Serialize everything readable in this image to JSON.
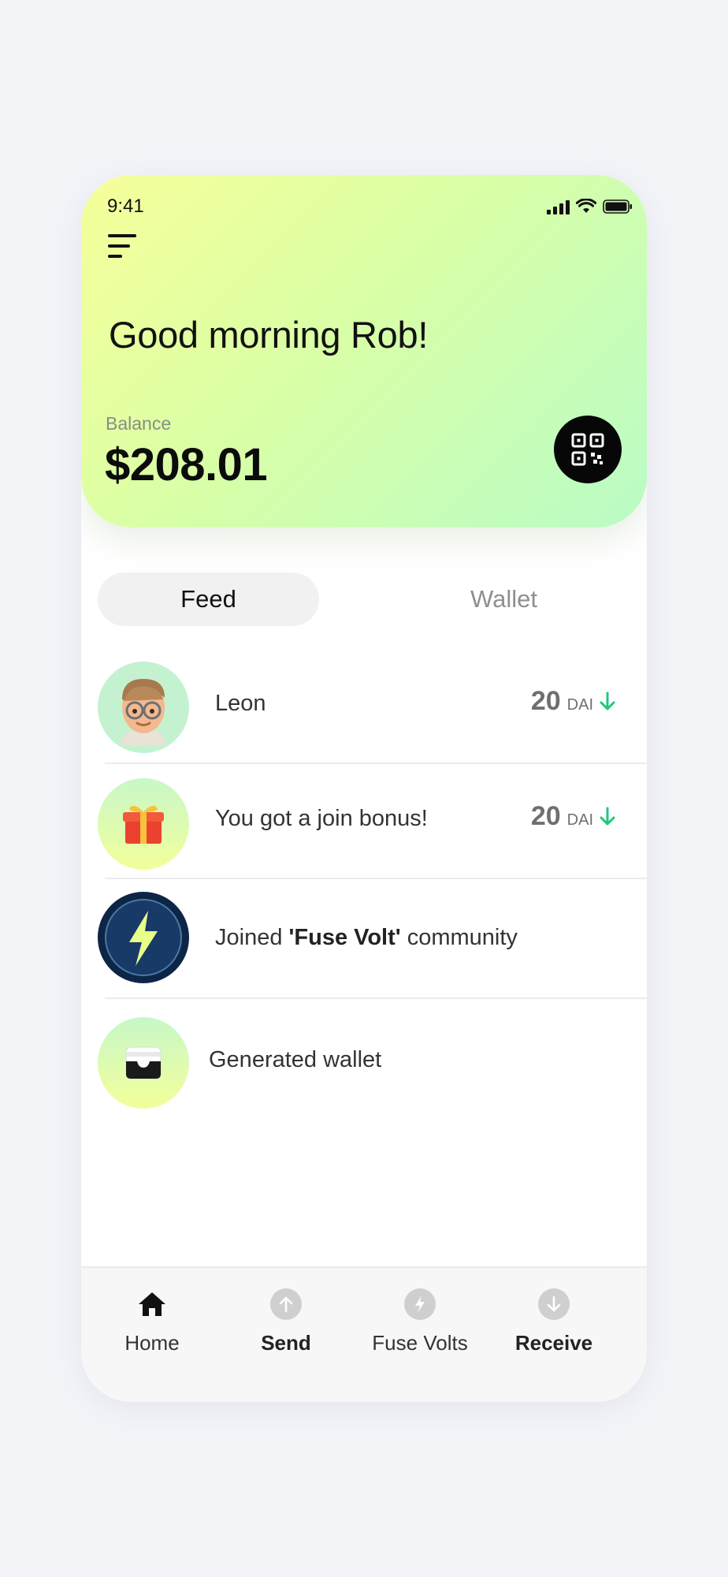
{
  "status_bar": {
    "time": "9:41"
  },
  "header": {
    "greeting": "Good morning Rob!",
    "balance_label": "Balance",
    "balance_value": "$208.01"
  },
  "tabs": [
    {
      "label": "Feed",
      "active": true
    },
    {
      "label": "Wallet",
      "active": false
    }
  ],
  "feed": {
    "items": [
      {
        "name": "Leon",
        "amount": "20",
        "unit": "DAI",
        "direction": "incoming",
        "avatar_icon": "memoji-avatar-icon"
      },
      {
        "name": "You got a join bonus!",
        "amount": "20",
        "unit": "DAI",
        "direction": "incoming",
        "avatar_icon": "gift-icon"
      },
      {
        "name_prefix": "Joined ",
        "name_bold": "'Fuse Volt'",
        "name_suffix": " community",
        "avatar_icon": "fuse-volt-bolt-icon"
      },
      {
        "name": "Generated wallet",
        "avatar_icon": "wallet-icon"
      }
    ]
  },
  "bottom_nav": {
    "items": [
      {
        "label": "Home",
        "icon": "home-icon"
      },
      {
        "label": "Send",
        "icon": "arrow-up-circle-icon"
      },
      {
        "label": "Fuse Volts",
        "icon": "bolt-circle-icon"
      },
      {
        "label": "Receive",
        "icon": "arrow-down-circle-icon"
      }
    ]
  },
  "colors": {
    "header_gradient_start": "#f7ff9a",
    "header_gradient_end": "#b9fcc6",
    "incoming_arrow": "#1fc77e",
    "qr_button": "#070707",
    "volt_badge": "#0d2547",
    "volt_bolt": "#e8ff8a"
  }
}
